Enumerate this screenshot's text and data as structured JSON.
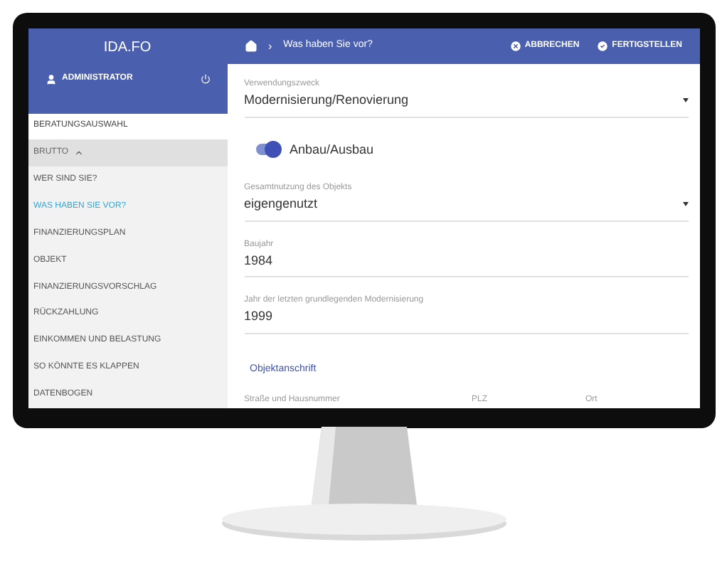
{
  "sidebar": {
    "title": "IDA.FO",
    "user": "ADMINISTRATOR",
    "items": [
      {
        "kind": "link",
        "label": "BERATUNGSAUSWAHL"
      },
      {
        "kind": "group",
        "label": "BRUTTO",
        "expanded": true,
        "children": [
          {
            "label": "WER SIND SIE?",
            "selected": false
          },
          {
            "label": "WAS HABEN SIE VOR?",
            "selected": true
          },
          {
            "label": "FINANZIERUNGSPLAN",
            "selected": false
          },
          {
            "label": "OBJEKT",
            "selected": false
          },
          {
            "label": "FINANZIERUNGSVORSCHLAG",
            "selected": false
          },
          {
            "label": "RÜCKZAHLUNG",
            "selected": false
          },
          {
            "label": "EINKOMMEN UND BELASTUNG",
            "selected": false
          },
          {
            "label": "SO KÖNNTE ES KLAPPEN",
            "selected": false
          },
          {
            "label": "DATENBOGEN",
            "selected": false
          }
        ]
      }
    ]
  },
  "header": {
    "breadcrumb": "›",
    "title": "Was haben Sie vor?",
    "actions": [
      {
        "kind": "cancel",
        "label": "ABBRECHEN"
      },
      {
        "kind": "finish",
        "label": "FERTIGSTELLEN"
      }
    ]
  },
  "form": [
    {
      "kind": "select",
      "label": "Verwendungszweck",
      "value": "Modernisierung/Renovierung"
    },
    {
      "kind": "toggle",
      "label": "Anbau/Ausbau",
      "on": true
    },
    {
      "kind": "select",
      "label": "Gesamtnutzung des Objekts",
      "value": "eigengenutzt"
    },
    {
      "kind": "input",
      "label": "Baujahr",
      "value": "1984"
    },
    {
      "kind": "input",
      "label": "Jahr der letzten grundlegenden Modernisierung",
      "value": "1999"
    },
    {
      "kind": "section",
      "label": "Objektanschrift"
    },
    {
      "kind": "columns",
      "labels": [
        "Straße und Hausnummer",
        "PLZ",
        "Ort"
      ]
    }
  ]
}
